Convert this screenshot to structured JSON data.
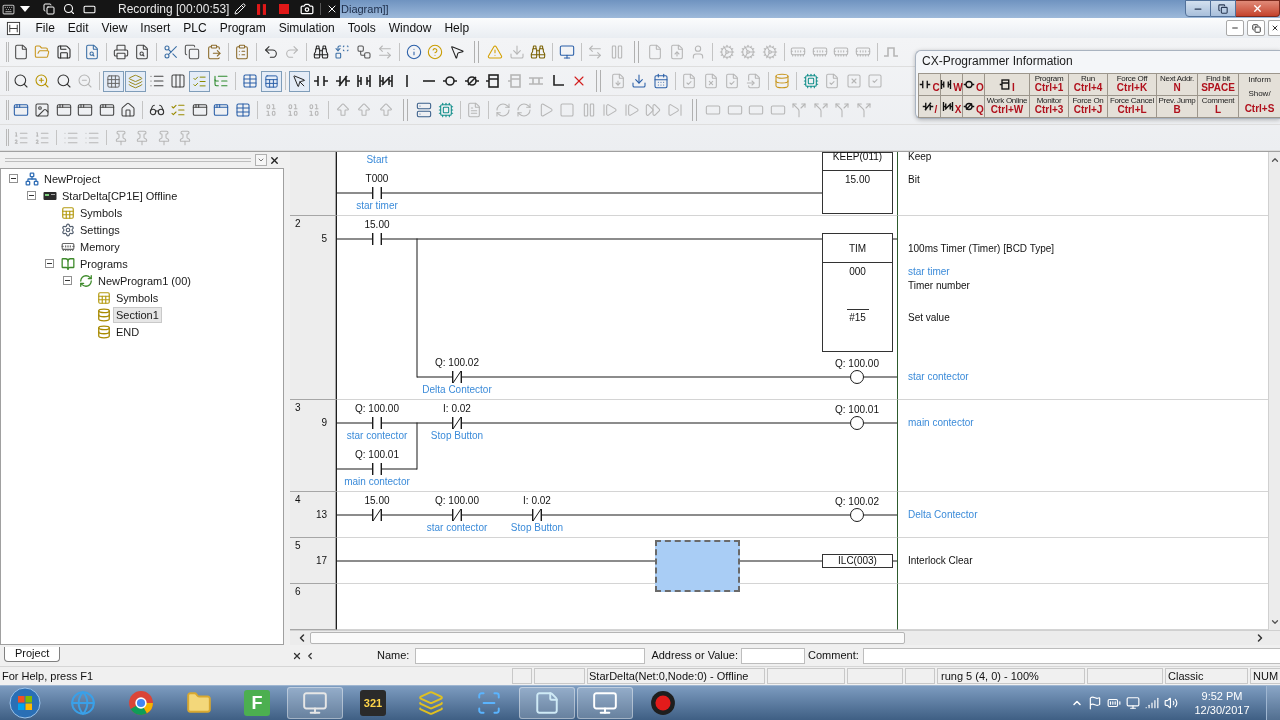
{
  "recording": {
    "status": "Recording [00:00:53]"
  },
  "window": {
    "title": "Diagram]]"
  },
  "menu": [
    "File",
    "Edit",
    "View",
    "Insert",
    "PLC",
    "Program",
    "Simulation",
    "Tools",
    "Window",
    "Help"
  ],
  "toolbars": [
    {
      "buttons": [
        {
          "disabled": false
        },
        {
          "disabled": false
        },
        {
          "disabled": false
        },
        {
          "disabled": false
        },
        {
          "disabled": false
        },
        {
          "disabled": false
        },
        {
          "disabled": false
        },
        {
          "disabled": false
        },
        {
          "disabled": false
        },
        {
          "disabled": false
        },
        {
          "disabled": false
        },
        {
          "disabled": true
        },
        {
          "disabled": false
        },
        {
          "disabled": false
        },
        {
          "disabled": false
        },
        {
          "disabled": true
        },
        {
          "disabled": false
        },
        {
          "disabled": false
        },
        {
          "disabled": false
        },
        {
          "disabled": false
        },
        {
          "disabled": true
        },
        {
          "disabled": false
        },
        {
          "disabled": false
        },
        {
          "disabled": true
        },
        {
          "disabled": true
        },
        {
          "disabled": true
        },
        {
          "disabled": true
        },
        {
          "disabled": true
        },
        {
          "disabled": true
        },
        {
          "disabled": true
        },
        {
          "disabled": true
        },
        {
          "disabled": true
        },
        {
          "disabled": true
        },
        {
          "disabled": true
        },
        {
          "disabled": true
        },
        {
          "disabled": true
        }
      ]
    },
    {
      "buttons": [
        {
          "disabled": false
        },
        {
          "disabled": false
        },
        {
          "disabled": false
        },
        {
          "disabled": true
        },
        {
          "disabled": false,
          "pressed": true
        },
        {
          "disabled": false,
          "pressed": true
        },
        {
          "disabled": false,
          "pressed": false
        },
        {
          "disabled": false,
          "pressed": false
        },
        {
          "disabled": false,
          "pressed": true
        },
        {
          "disabled": false,
          "pressed": false
        },
        {
          "disabled": false,
          "pressed": false
        },
        {
          "disabled": false,
          "pressed": true
        },
        {
          "disabled": false,
          "pressed": true
        },
        {
          "disabled": false
        },
        {
          "disabled": false
        },
        {
          "disabled": false
        },
        {
          "disabled": false
        },
        {
          "disabled": false
        },
        {
          "disabled": false
        },
        {
          "disabled": false
        },
        {
          "disabled": false
        },
        {
          "disabled": false
        },
        {
          "disabled": true
        },
        {
          "disabled": true
        },
        {
          "disabled": false
        },
        {
          "disabled": false
        },
        {
          "disabled": true
        },
        {
          "disabled": false
        },
        {
          "disabled": false
        },
        {
          "disabled": true
        },
        {
          "disabled": true
        },
        {
          "disabled": true
        },
        {
          "disabled": true
        },
        {
          "disabled": false
        },
        {
          "disabled": false
        },
        {
          "disabled": true
        },
        {
          "disabled": true
        },
        {
          "disabled": true
        }
      ]
    },
    {
      "buttons": [
        {
          "disabled": false
        },
        {
          "disabled": false
        },
        {
          "disabled": false
        },
        {
          "disabled": false
        },
        {
          "disabled": false
        },
        {
          "disabled": false
        },
        {
          "disabled": false
        },
        {
          "disabled": false
        },
        {
          "disabled": false
        },
        {
          "disabled": false
        },
        {
          "disabled": false
        },
        {
          "disabled": true
        },
        {
          "disabled": true
        },
        {
          "disabled": true
        },
        {
          "disabled": true
        },
        {
          "disabled": true
        },
        {
          "disabled": true
        },
        {
          "disabled": false
        },
        {
          "disabled": false
        },
        {
          "disabled": true
        },
        {
          "disabled": true
        },
        {
          "disabled": true
        },
        {
          "disabled": true
        },
        {
          "disabled": true
        },
        {
          "disabled": true
        },
        {
          "disabled": true
        },
        {
          "disabled": true
        },
        {
          "disabled": true
        },
        {
          "disabled": true
        },
        {
          "disabled": true
        },
        {
          "disabled": true
        },
        {
          "disabled": true
        },
        {
          "disabled": true
        },
        {
          "disabled": true
        },
        {
          "disabled": true
        },
        {
          "disabled": true
        },
        {
          "disabled": true
        }
      ]
    },
    {
      "buttons": [
        {
          "disabled": true
        },
        {
          "disabled": true
        },
        {
          "disabled": true
        },
        {
          "disabled": true
        },
        {
          "disabled": true
        },
        {
          "disabled": true
        },
        {
          "disabled": true
        },
        {
          "disabled": true
        }
      ]
    }
  ],
  "info_panel": {
    "title": "CX-Programmer Information",
    "rows": [
      [
        {
          "kind": "symbol",
          "key": "C"
        },
        {
          "kind": "symbol",
          "key": "W"
        },
        {
          "kind": "symbol",
          "key": "O"
        },
        {
          "kind": "symbol",
          "key": "I"
        },
        {
          "kind": "command",
          "label": "Program",
          "key": "Ctrl+1"
        },
        {
          "kind": "command",
          "label": "Run",
          "key": "Ctrl+4"
        },
        {
          "kind": "command",
          "label": "Force Off",
          "key": "Ctrl+K"
        },
        {
          "kind": "command",
          "label": "Next Addr.",
          "key": "N"
        },
        {
          "kind": "command",
          "label": "Find bit",
          "key": "SPACE"
        }
      ],
      [
        {
          "kind": "symbol",
          "key": "/"
        },
        {
          "kind": "symbol",
          "key": "X"
        },
        {
          "kind": "symbol",
          "key": "Q"
        },
        {
          "kind": "command",
          "label": "Work Online",
          "key": "Ctrl+W"
        },
        {
          "kind": "command",
          "label": "Monitor",
          "key": "Ctrl+3"
        },
        {
          "kind": "command",
          "label": "Force On",
          "key": "Ctrl+J"
        },
        {
          "kind": "command",
          "label": "Force Cancel",
          "key": "Ctrl+L"
        },
        {
          "kind": "command",
          "label": "Prev. Jump",
          "key": "B"
        },
        {
          "kind": "command",
          "label": "Comment",
          "key": "L"
        }
      ]
    ],
    "side": {
      "label": "Inform",
      "label_2": "Show/",
      "key": "Ctrl+S"
    }
  },
  "project_tree": {
    "items": [
      {
        "label": "NewProject",
        "kind": "project",
        "expanded": true,
        "selected": false,
        "children": [
          {
            "label": "StarDelta[CP1E] Offline",
            "kind": "plc",
            "expanded": true,
            "selected": false,
            "children": [
              {
                "label": "Symbols",
                "kind": "symbols",
                "selected": false
              },
              {
                "label": "Settings",
                "kind": "settings",
                "selected": false
              },
              {
                "label": "Memory",
                "kind": "memory",
                "selected": false
              },
              {
                "label": "Programs",
                "kind": "programs",
                "expanded": true,
                "selected": false,
                "children": [
                  {
                    "label": "NewProgram1 (00)",
                    "kind": "program",
                    "expanded": true,
                    "selected": false,
                    "children": [
                      {
                        "label": "Symbols",
                        "kind": "symbols",
                        "selected": false
                      },
                      {
                        "label": "Section1",
                        "kind": "section",
                        "selected": true
                      },
                      {
                        "label": "END",
                        "kind": "section",
                        "selected": false
                      }
                    ]
                  }
                ]
              }
            ]
          }
        ]
      }
    ]
  },
  "project_tab": {
    "label": "Project",
    "selected": true
  },
  "ladder": {
    "rungs": [
      {
        "cut_off": true,
        "rows": [
          {
            "kind": "main",
            "cells": [
              {
                "kind": "offscreen",
                "comment": "Start"
              },
              {
                "kind": "empty"
              },
              {
                "kind": "empty"
              },
              {
                "kind": "empty"
              },
              {
                "kind": "empty"
              },
              {
                "kind": "empty"
              },
              {
                "kind": "block",
                "header": "KEEP(011)",
                "header_comment": "Keep",
                "operands": [
                  {
                    "value": "15.00",
                    "description": "Bit"
                  }
                ]
              }
            ]
          },
          {
            "kind": "main",
            "cells": [
              {
                "kind": "contact_no",
                "address": "T000",
                "comment": "star timer"
              },
              {
                "kind": "wire"
              },
              {
                "kind": "wire"
              },
              {
                "kind": "wire"
              },
              {
                "kind": "wire"
              },
              {
                "kind": "wire"
              },
              {
                "kind": "empty"
              }
            ]
          }
        ]
      },
      {
        "number": "2",
        "step": "5",
        "rows": [
          {
            "kind": "main",
            "cells": [
              {
                "kind": "contact_no",
                "address": "15.00"
              },
              {
                "kind": "wire"
              },
              {
                "kind": "wire"
              },
              {
                "kind": "wire"
              },
              {
                "kind": "wire"
              },
              {
                "kind": "wire"
              },
              {
                "kind": "block",
                "header": "TIM",
                "header_comment": "100ms Timer (Timer) [BCD Type]",
                "operands": [
                  {
                    "value": "000",
                    "note": "star timer",
                    "description": "Timer number"
                  },
                  {
                    "value": "#15",
                    "description": "Set value"
                  }
                ]
              }
            ]
          },
          {
            "kind": "split",
            "cells": [
              {
                "kind": "empty"
              },
              {
                "kind": "contact_nc",
                "address": "Q: 100.02",
                "comment": "Delta Contector"
              },
              {
                "kind": "wire"
              },
              {
                "kind": "wire"
              },
              {
                "kind": "wire"
              },
              {
                "kind": "wire"
              },
              {
                "kind": "coil",
                "address": "Q: 100.00",
                "comment": "star contector"
              }
            ]
          }
        ]
      },
      {
        "number": "3",
        "step": "9",
        "rows": [
          {
            "kind": "main",
            "cells": [
              {
                "kind": "contact_no",
                "address": "Q: 100.00",
                "comment": "star contector"
              },
              {
                "kind": "contact_nc",
                "address": "I: 0.02",
                "comment": "Stop Button"
              },
              {
                "kind": "wire"
              },
              {
                "kind": "wire"
              },
              {
                "kind": "wire"
              },
              {
                "kind": "wire"
              },
              {
                "kind": "coil",
                "address": "Q: 100.01",
                "comment": "main contector"
              }
            ]
          },
          {
            "kind": "join",
            "cells": [
              {
                "kind": "contact_no",
                "address": "Q: 100.01",
                "comment": "main contector"
              },
              {
                "kind": "empty"
              },
              {
                "kind": "empty"
              },
              {
                "kind": "empty"
              },
              {
                "kind": "empty"
              },
              {
                "kind": "empty"
              },
              {
                "kind": "empty"
              }
            ]
          }
        ]
      },
      {
        "number": "4",
        "step": "13",
        "rows": [
          {
            "kind": "main",
            "cells": [
              {
                "kind": "contact_nc",
                "address": "15.00"
              },
              {
                "kind": "contact_nc",
                "address": "Q: 100.00",
                "comment": "star contector"
              },
              {
                "kind": "contact_nc",
                "address": "I: 0.02",
                "comment": "Stop Button"
              },
              {
                "kind": "wire"
              },
              {
                "kind": "wire"
              },
              {
                "kind": "wire"
              },
              {
                "kind": "coil",
                "address": "Q: 100.02",
                "comment": "Delta Contector"
              }
            ]
          }
        ]
      },
      {
        "number": "5",
        "step": "17",
        "rows": [
          {
            "kind": "main",
            "cells": [
              {
                "kind": "wire"
              },
              {
                "kind": "wire"
              },
              {
                "kind": "wire"
              },
              {
                "kind": "wire"
              },
              {
                "kind": "wire",
                "cursor": true
              },
              {
                "kind": "wire"
              },
              {
                "kind": "function",
                "header": "ILC(003)",
                "header_comment": "Interlock Clear"
              }
            ]
          }
        ]
      },
      {
        "number": "6"
      }
    ]
  },
  "name_bar": {
    "name_label": "Name:",
    "address_label": "Address or Value:",
    "comment_label": "Comment:"
  },
  "status_bar": {
    "help": "For Help, press F1",
    "connection": "StarDelta(Net:0,Node:0) - Offline",
    "position": "rung 5 (4, 0) - 100%",
    "mode": "Classic",
    "keyboard": "NUM"
  },
  "taskbar": {
    "apps": [
      {
        "running": false
      },
      {
        "running": false
      },
      {
        "running": false
      },
      {
        "label": "F",
        "running": false
      },
      {
        "running": true
      },
      {
        "label": "321",
        "running": false
      },
      {
        "running": false
      },
      {
        "running": false
      },
      {
        "running": true
      },
      {
        "running": true
      },
      {
        "running": false
      }
    ],
    "clock": {
      "time": "9:52 PM",
      "date": "12/30/2017"
    }
  }
}
